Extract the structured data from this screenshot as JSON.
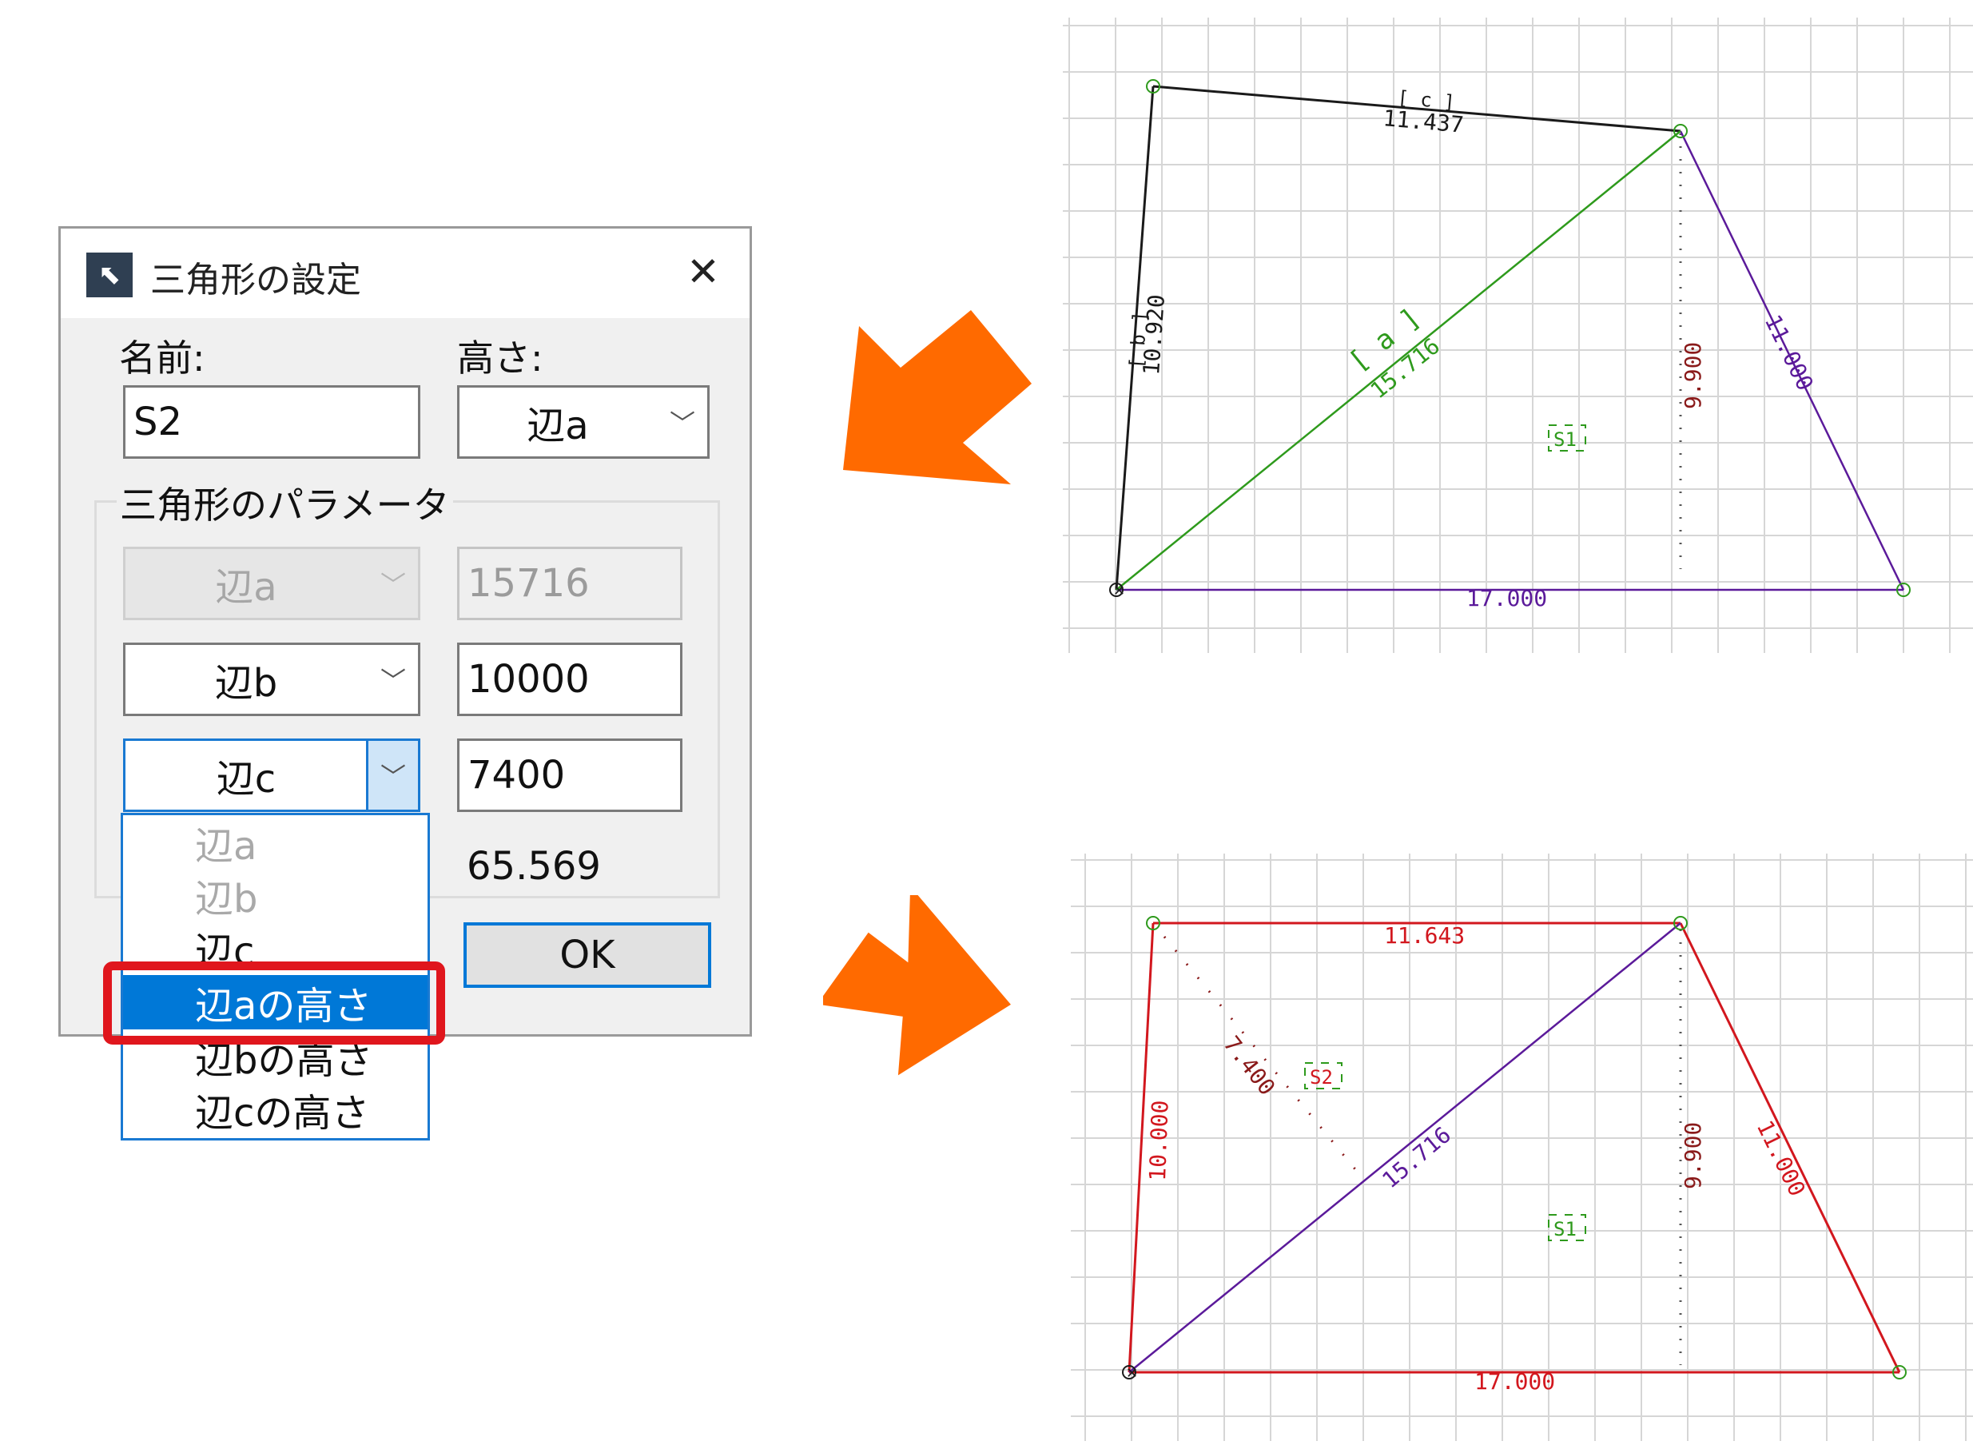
{
  "dialog": {
    "title": "三角形の設定",
    "close_symbol": "✕",
    "name_label": "名前:",
    "name_value": "S2",
    "height_label": "高さ:",
    "height_value": "辺a",
    "group_label": "三角形のパラメータ",
    "rows": [
      {
        "select": "辺a",
        "value": "15716",
        "disabled": true
      },
      {
        "select": "辺b",
        "value": "10000",
        "disabled": false
      },
      {
        "select": "辺c",
        "value": "7400",
        "disabled": false
      }
    ],
    "angle_value": "65.569",
    "ok_label": "OK",
    "dropdown_options": [
      {
        "label": "辺a",
        "state": "disabled"
      },
      {
        "label": "辺b",
        "state": "disabled"
      },
      {
        "label": "辺c",
        "state": "normal"
      },
      {
        "label": "辺aの高さ",
        "state": "selected"
      },
      {
        "label": "辺bの高さ",
        "state": "normal"
      },
      {
        "label": "辺cの高さ",
        "state": "normal"
      }
    ]
  },
  "arrow_color": "#ff6a00",
  "highlight_color": "#e0161d",
  "top_drawing": {
    "side_c_tag": "[ c ]",
    "side_c_length": "11.437",
    "side_b_tag": "[ b ]",
    "side_b_length": "10.920",
    "side_a_tag": "[ a ]",
    "side_a_length": "15.716",
    "right_side_length": "11.000",
    "bottom_length": "17.000",
    "height_length": "9.900",
    "triangle_tag": "S1",
    "colors": {
      "black": "#1a1a1a",
      "green": "#2e9a1c",
      "purple": "#5b1a9a",
      "darkred": "#8a1a1a"
    }
  },
  "bottom_drawing": {
    "top_length": "11.643",
    "left_length": "10.000",
    "diagonal_length": "15.716",
    "right_side_length": "11.000",
    "bottom_length": "17.000",
    "height_length": "9.900",
    "altitude_length": "7.400",
    "new_tag": "S2",
    "old_tag": "S1",
    "colors": {
      "red": "#d2171e",
      "purple": "#5b1a9a",
      "darkred": "#8a1a1a",
      "green": "#2e9a1c"
    }
  }
}
